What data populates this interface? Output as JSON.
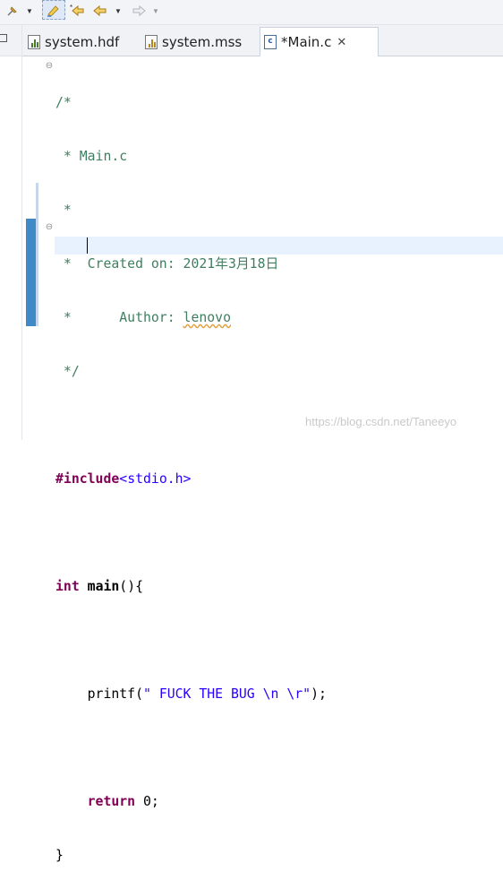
{
  "toolbar": {
    "buttons": [
      "pin-editor",
      "toggle-annotation",
      "last-edit-location",
      "back",
      "forward"
    ]
  },
  "tabs": [
    {
      "label": "system.hdf",
      "icon": "hdf-file-icon",
      "active": false
    },
    {
      "label": "system.mss",
      "icon": "mss-file-icon",
      "active": false
    },
    {
      "label": "*Main.c",
      "icon": "c-source-file-icon",
      "active": true,
      "close": "✕"
    }
  ],
  "editor": {
    "comment": {
      "l1": "/*",
      "l2": " * Main.c",
      "l3": " *",
      "l4": " *  Created on: 2021年3月18日",
      "l5_prefix": " *      Author: ",
      "l5_author": "lenovo",
      "l6": " */"
    },
    "include_kw": "#include",
    "include_file": "<stdio.h>",
    "int_kw": "int",
    "main_fn": "main",
    "main_rest": "(){",
    "printf_pre": "    printf(",
    "printf_str": "\" FUCK THE BUG \\n \\r\"",
    "printf_post": ");",
    "return_indent": "    ",
    "return_kw": "return",
    "return_rest": " 0;",
    "close_brace": "}"
  },
  "watermark": "https://blog.csdn.net/Taneeyo",
  "colors": {
    "comment": "#3f7f5f",
    "keyword": "#7f0055",
    "string": "#2a00ff",
    "current_line": "#e8f2fe",
    "change_ruler": "#3f89c7"
  }
}
